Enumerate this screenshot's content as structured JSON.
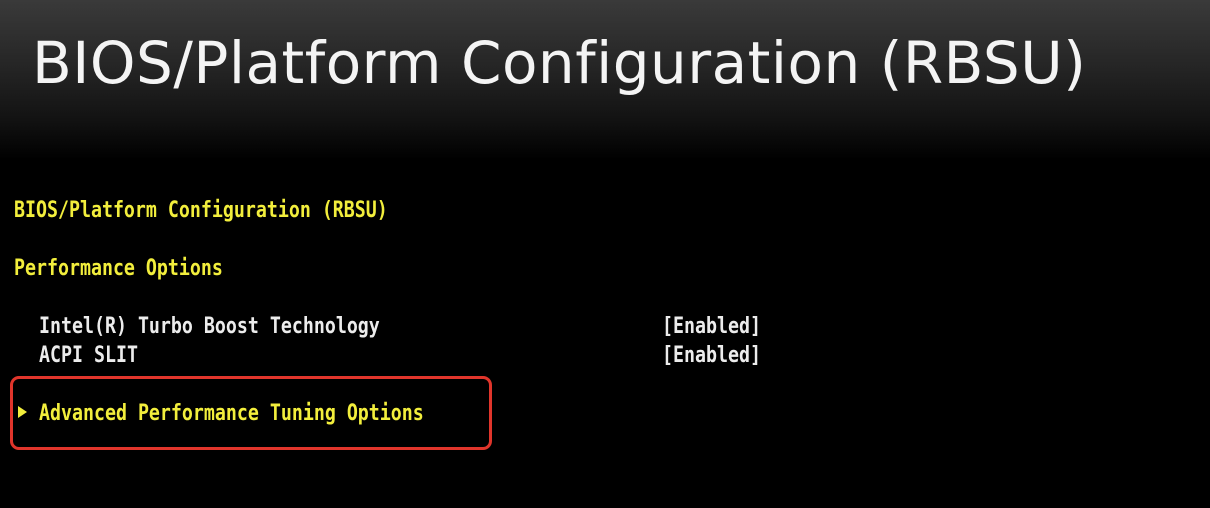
{
  "banner": {
    "title": "BIOS/Platform Configuration (RBSU)"
  },
  "bios": {
    "heading": "BIOS/Platform Configuration (RBSU)",
    "section": "Performance Options",
    "options": [
      {
        "label": "Intel(R) Turbo Boost Technology",
        "value": "[Enabled]"
      },
      {
        "label": "ACPI SLIT",
        "value": "[Enabled]"
      }
    ],
    "submenu": {
      "label": "Advanced Performance Tuning Options",
      "icon": "submenu-arrow-icon"
    }
  },
  "colors": {
    "background": "#000000",
    "bios_text_yellow": "#f2ee3c",
    "bios_text_white": "#ececec",
    "highlight_border": "#e0352b",
    "banner_text": "#f4f4f4"
  }
}
